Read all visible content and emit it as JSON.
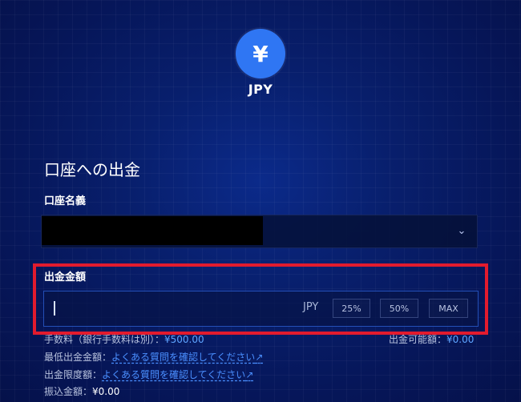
{
  "header": {
    "currency_symbol": "¥",
    "currency_code": "JPY"
  },
  "withdrawal_section": {
    "title": "口座への出金",
    "account_name_label": "口座名義",
    "amount_label": "出金金額",
    "amount_currency": "JPY",
    "quick_buttons": [
      "25%",
      "50%",
      "MAX"
    ]
  },
  "info": {
    "fee_label": "手数料（銀行手数料は別）：",
    "fee_value": "¥500.00",
    "available_label": "出金可能額：",
    "available_value": "¥0.00",
    "minimum_label": "最低出金金額：",
    "faq_text": "よくある質問を確認してください",
    "limit_label": "出金限度額：",
    "transfer_label": "振込金額：",
    "transfer_value": "¥0.00",
    "external_link_icon": "↗"
  },
  "colors": {
    "accent": "#2f76f3",
    "highlight": "#e21b2e",
    "link": "#4a8fff"
  }
}
